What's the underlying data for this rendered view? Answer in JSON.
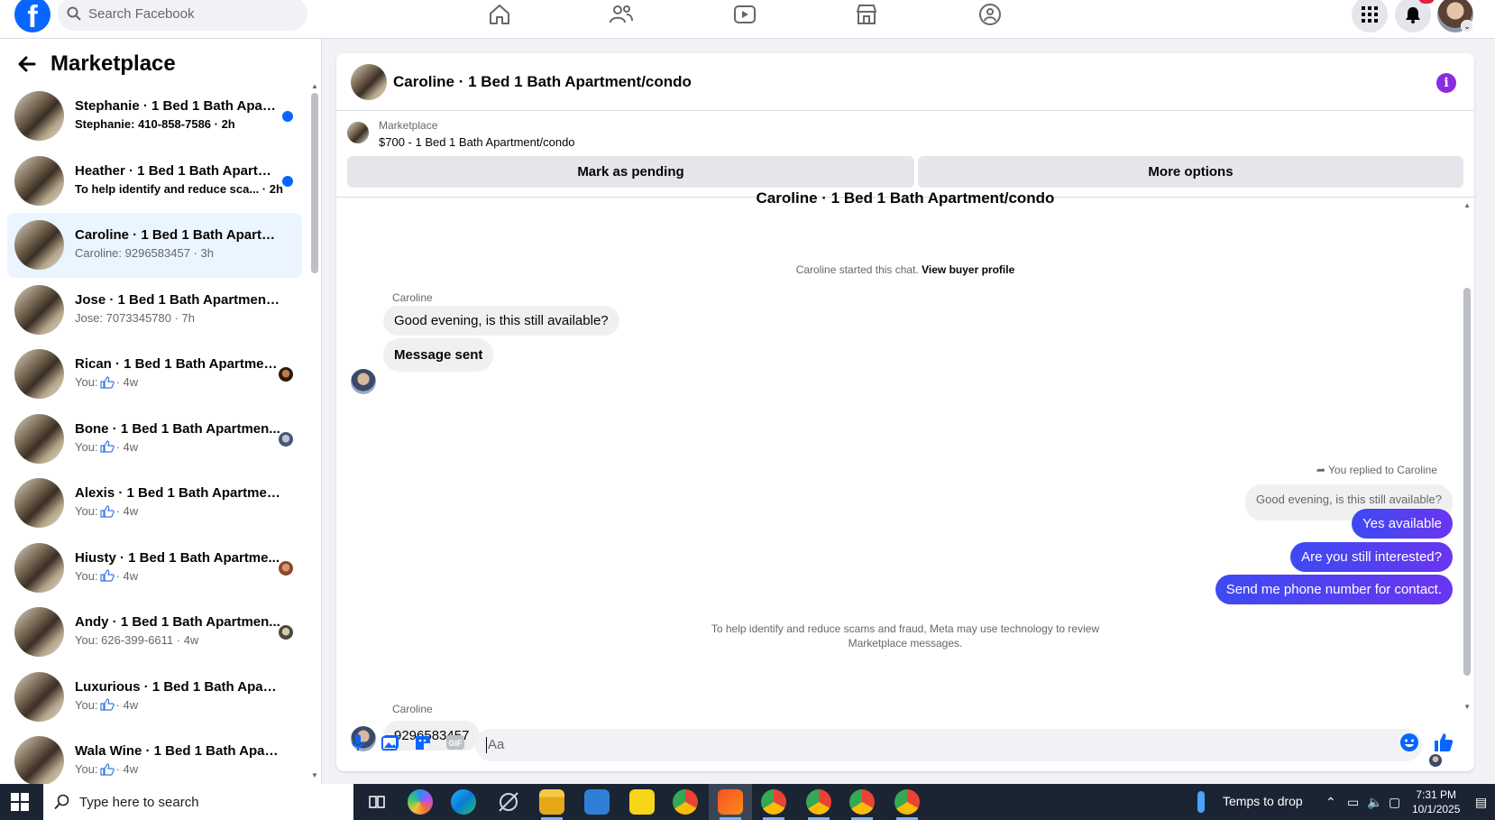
{
  "topbar": {
    "search_placeholder": "Search Facebook",
    "logo": "f",
    "notifications_count": "2",
    "icons": [
      "home-icon",
      "friends-icon",
      "video-icon",
      "marketplace-icon",
      "groups-icon",
      "menu-grid-icon",
      "bell-icon"
    ]
  },
  "sidebar": {
    "title": "Marketplace",
    "conversations": [
      {
        "name": "Stephanie · 1 Bed 1 Bath Apart...",
        "snippet": "Stephanie: 410-858-7586 · 2h",
        "unread": true
      },
      {
        "name": "Heather · 1 Bed 1 Bath Apartm...",
        "snippet": "To help identify and reduce sca... · 2h",
        "unread": true
      },
      {
        "name": "Caroline · 1 Bed 1 Bath Apartme...",
        "snippet": "Caroline: 9296583457 · 3h",
        "active": true
      },
      {
        "name": "Jose · 1 Bed 1 Bath Apartment/c...",
        "snippet": "Jose: 7073345780 · 7h"
      },
      {
        "name": "Rican · 1 Bed 1 Bath Apartmen...",
        "snippet_prefix": "You:",
        "snippet_suffix": "· 4w",
        "thumb": true
      },
      {
        "name": "Bone · 1 Bed 1 Bath Apartmen...",
        "snippet_prefix": "You:",
        "snippet_suffix": "· 4w",
        "thumb": true
      },
      {
        "name": "Alexis · 1 Bed 1 Bath Apartment/...",
        "snippet_prefix": "You:",
        "snippet_suffix": "· 4w",
        "thumb": true
      },
      {
        "name": "Hiusty · 1 Bed 1 Bath Apartme...",
        "snippet_prefix": "You:",
        "snippet_suffix": "· 4w",
        "thumb": true
      },
      {
        "name": "Andy · 1 Bed 1 Bath Apartmen...",
        "snippet": "You: 626-399-6611 · 4w"
      },
      {
        "name": "Luxurious · 1 Bed 1 Bath Apartm...",
        "snippet_prefix": "You:",
        "snippet_suffix": "· 4w",
        "thumb": true
      },
      {
        "name": "Wala Wine · 1 Bed 1 Bath Apart...",
        "snippet_prefix": "You:",
        "snippet_suffix": "· 4w",
        "thumb": true
      }
    ]
  },
  "chat": {
    "title": "Caroline · 1 Bed 1 Bath Apartment/condo",
    "listing_category": "Marketplace",
    "listing_price_title": "$700 - 1 Bed 1 Bath Apartment/condo",
    "mark_pending_label": "Mark as pending",
    "more_options_label": "More options",
    "heading": "Caroline · 1 Bed 1 Bath Apartment/condo",
    "started_text": "Caroline started this chat.",
    "view_profile_label": "View buyer profile",
    "sender_name": "Caroline",
    "incoming_1": "Good evening, is this still available?",
    "incoming_2": "Message sent",
    "replied_label": "You replied to Caroline",
    "quoted_text": "Good evening, is this still available?",
    "outgoing": [
      "Yes available",
      "Are you still interested?",
      "Send me phone number for contact."
    ],
    "notice_line1": "To help identify and reduce scams and fraud, Meta may use technology to review",
    "notice_line2": "Marketplace messages.",
    "incoming_3": "9296583457",
    "composer_placeholder": "Aa"
  },
  "taskbar": {
    "search_placeholder": "Type here to search",
    "weather_text": "Temps to drop",
    "time": "7:31 PM",
    "date": "10/1/2025"
  },
  "colors": {
    "brand_blue": "#0866ff",
    "outgoing_bubble": "#5b3cf5",
    "info_purple": "#8a2be2"
  }
}
